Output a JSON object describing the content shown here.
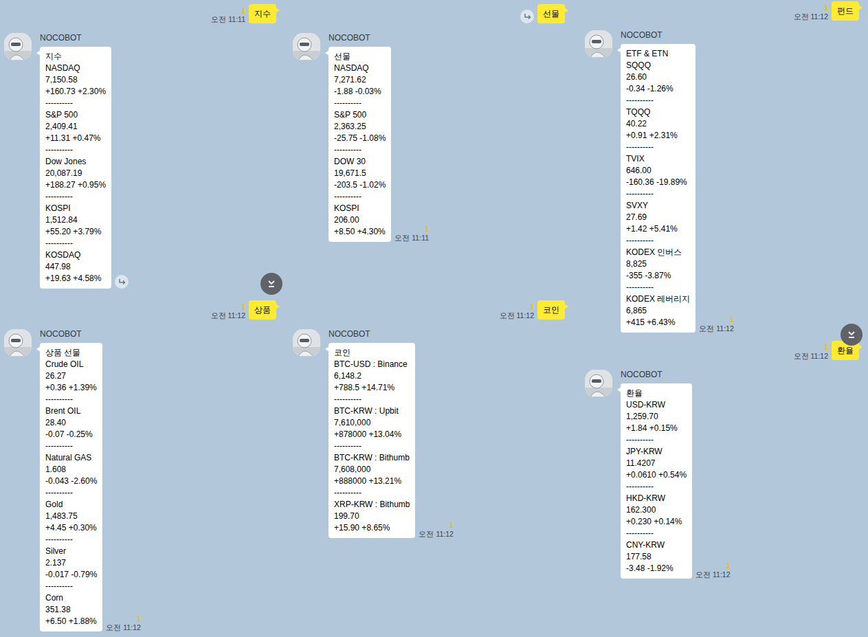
{
  "chats": [
    {
      "query": {
        "text": "지수",
        "unread": "1",
        "time": "오전 11:11",
        "share": false
      },
      "reply": {
        "sender": "NOCOBOT",
        "title": "지수",
        "separator": "----------",
        "share": true,
        "items": [
          {
            "name": "NASDAQ",
            "value": "7,150.58",
            "change": "+160.73 +2.30%"
          },
          {
            "name": "S&P 500",
            "value": "2,409.41",
            "change": "+11.31 +0.47%"
          },
          {
            "name": "Dow Jones",
            "value": "20,087.19",
            "change": "+188.27 +0.95%"
          },
          {
            "name": "KOSPI",
            "value": "1,512.84",
            "change": "+55.20 +3.79%"
          },
          {
            "name": "KOSDAQ",
            "value": "447.98",
            "change": "+19.63 +4.58%"
          }
        ]
      }
    },
    {
      "query": {
        "text": "선물",
        "share": true
      },
      "reply": {
        "sender": "NOCOBOT",
        "title": "선물",
        "separator": "----------",
        "share": false,
        "unread": "1",
        "time": "오전 11:11",
        "items": [
          {
            "name": "NASDAQ",
            "value": "7,271.62",
            "change": "-1.88 -0.03%"
          },
          {
            "name": "S&P 500",
            "value": "2,363.25",
            "change": "-25.75 -1.08%"
          },
          {
            "name": "DOW 30",
            "value": "19,671.5",
            "change": "-203.5 -1.02%"
          },
          {
            "name": "KOSPI",
            "value": "206.00",
            "change": "+8.50 +4.30%"
          }
        ]
      }
    },
    {
      "query": {
        "text": "펀드",
        "unread": "1",
        "time": "오전 11:12",
        "share": false
      },
      "reply": {
        "sender": "NOCOBOT",
        "title": "ETF & ETN",
        "separator": "----------",
        "share": false,
        "unread": "1",
        "time": "오전 11:12",
        "items": [
          {
            "name": "SQQQ",
            "value": "26.60",
            "change": "-0.34 -1.26%"
          },
          {
            "name": "TQQQ",
            "value": "40.22",
            "change": "+0.91 +2.31%"
          },
          {
            "name": "TVIX",
            "value": "646.00",
            "change": "-160.36 -19.89%"
          },
          {
            "name": "SVXY",
            "value": "27.69",
            "change": "+1.42 +5.41%"
          },
          {
            "name": "KODEX 인버스",
            "value": "8,825",
            "change": "-355 -3.87%"
          },
          {
            "name": "KODEX 레버리지",
            "value": "6,865",
            "change": "+415 +6.43%"
          }
        ]
      }
    },
    {
      "query": {
        "text": "상품",
        "unread": "1",
        "time": "오전 11:12",
        "share": false
      },
      "reply": {
        "sender": "NOCOBOT",
        "title": "상품 선물",
        "separator": "----------",
        "share": false,
        "unread": "1",
        "time": "오전 11:12",
        "items": [
          {
            "name": "Crude OIL",
            "value": "26.27",
            "change": "+0.36 +1.39%"
          },
          {
            "name": "Brent OIL",
            "value": "28.40",
            "change": "-0.07 -0.25%"
          },
          {
            "name": "Natural GAS",
            "value": "1.608",
            "change": "-0.043 -2.60%"
          },
          {
            "name": "Gold",
            "value": "1,483.75",
            "change": "+4.45 +0.30%"
          },
          {
            "name": "Silver",
            "value": "2.137",
            "change": "-0.017 -0.79%"
          },
          {
            "name": "Corn",
            "value": "351.38",
            "change": "+6.50 +1.88%"
          }
        ]
      }
    },
    {
      "query": {
        "text": "코인",
        "unread": "1",
        "time": "오전 11:12",
        "share": false
      },
      "reply": {
        "sender": "NOCOBOT",
        "title": "코인",
        "separator": "----------",
        "share": false,
        "unread": "1",
        "time": "오전 11:12",
        "items": [
          {
            "name": "BTC-USD : Binance",
            "value": "6,148.2",
            "change": "+788.5 +14.71%"
          },
          {
            "name": "BTC-KRW : Upbit",
            "value": "7,610,000",
            "change": "+878000 +13.04%"
          },
          {
            "name": "BTC-KRW : Bithumb",
            "value": "7,608,000",
            "change": "+888000 +13.21%"
          },
          {
            "name": "XRP-KRW : Bithumb",
            "value": "199.70",
            "change": "+15.90 +8.65%"
          }
        ]
      }
    },
    {
      "query": {
        "text": "환율",
        "unread": "1",
        "time": "오전 11:12",
        "share": false
      },
      "reply": {
        "sender": "NOCOBOT",
        "title": "환율",
        "separator": "----------",
        "share": false,
        "unread": "1",
        "time": "오전 11:12",
        "items": [
          {
            "name": "USD-KRW",
            "value": "1,259.70",
            "change": "+1.84 +0.15%"
          },
          {
            "name": "JPY-KRW",
            "value": "11.4207",
            "change": "+0.0610 +0.54%"
          },
          {
            "name": "HKD-KRW",
            "value": "162.300",
            "change": "+0.230 +0.14%"
          },
          {
            "name": "CNY-KRW",
            "value": "177.58",
            "change": "-3.48 -1.92%"
          }
        ]
      }
    }
  ]
}
